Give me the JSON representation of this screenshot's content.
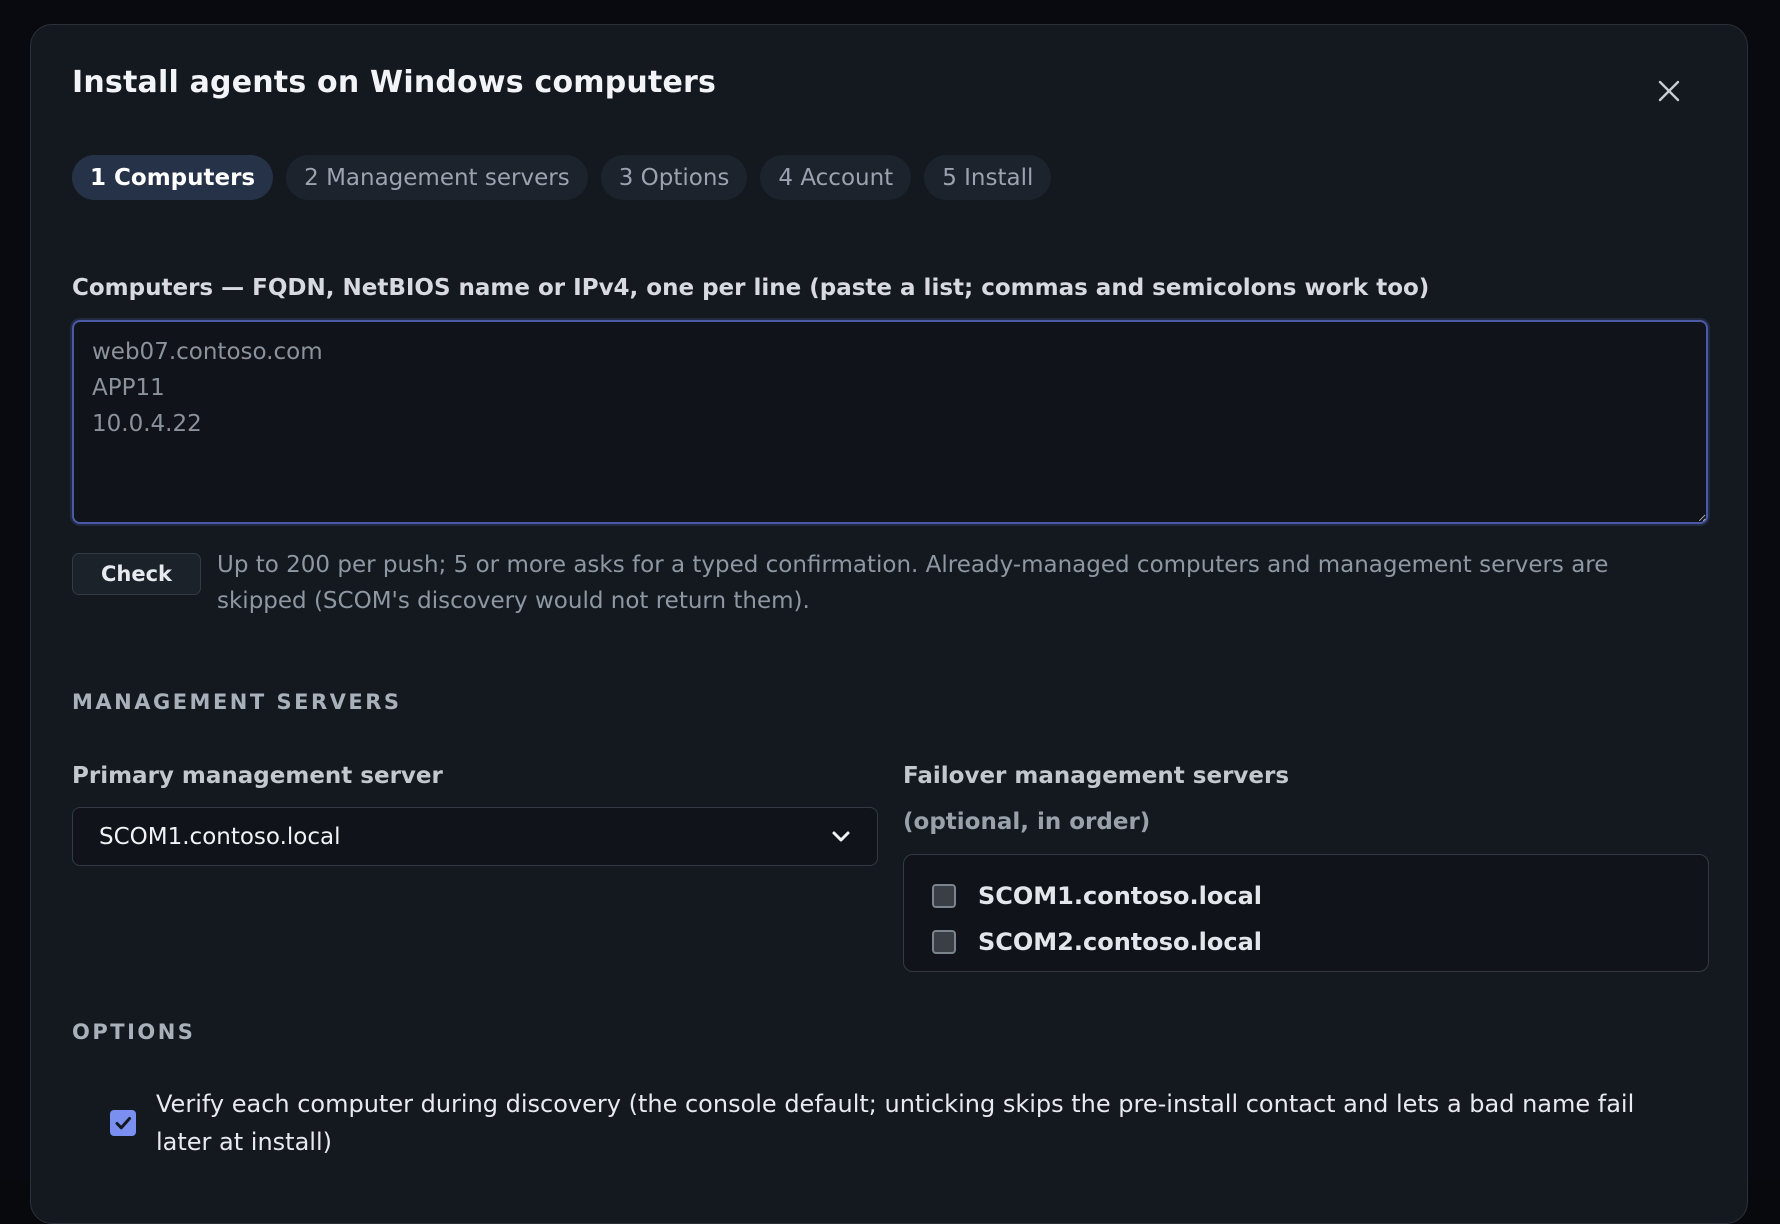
{
  "dialog": {
    "title": "Install agents on Windows computers",
    "close_icon": "close-icon"
  },
  "steps": [
    {
      "label": "1 Computers",
      "active": true
    },
    {
      "label": "2 Management servers",
      "active": false
    },
    {
      "label": "3 Options",
      "active": false
    },
    {
      "label": "4 Account",
      "active": false
    },
    {
      "label": "5 Install",
      "active": false
    }
  ],
  "computers": {
    "label": "Computers — FQDN, NetBIOS name or IPv4, one per line (paste a list; commas and semicolons work too)",
    "placeholder": "web07.contoso.com\nAPP11\n10.0.4.22",
    "value": "",
    "check_label": "Check",
    "hint": "Up to 200 per push; 5 or more asks for a typed confirmation. Already-managed computers and management servers are skipped (SCOM's discovery would not return them)."
  },
  "management_servers": {
    "heading": "MANAGEMENT SERVERS",
    "primary_label": "Primary management server",
    "primary_value": "SCOM1.contoso.local",
    "failover_label": "Failover management servers",
    "failover_sublabel": "(optional, in order)",
    "failover_options": [
      {
        "label": "SCOM1.contoso.local",
        "checked": false
      },
      {
        "label": "SCOM2.contoso.local",
        "checked": false
      }
    ]
  },
  "options": {
    "heading": "OPTIONS",
    "verify_label": "Verify each computer during discovery (the console default; unticking skips the pre-install contact and lets a bad name fail later at install)",
    "verify_checked": true
  },
  "colors": {
    "accent": "#7b8ff0",
    "focus_border": "#4c5aa6",
    "modal_bg": "#141920"
  }
}
